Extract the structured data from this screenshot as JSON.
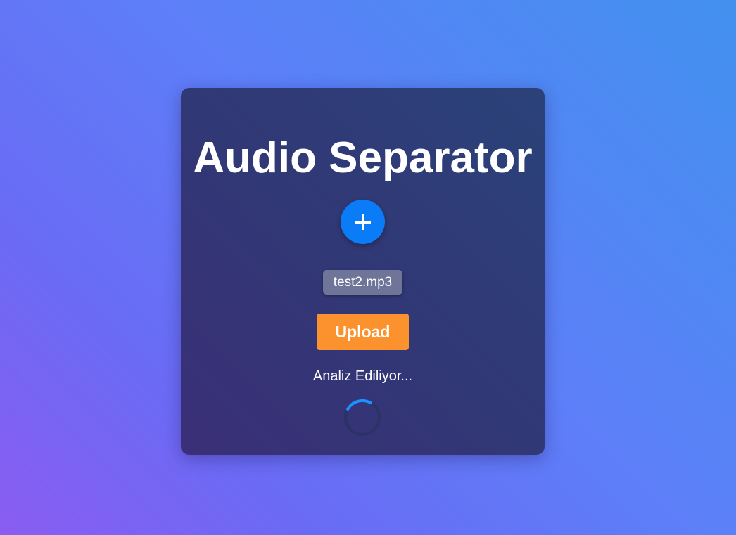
{
  "app": {
    "title": "Audio Separator"
  },
  "file": {
    "name": "test2.mp3"
  },
  "actions": {
    "add_symbol": "+",
    "upload_label": "Upload"
  },
  "status": {
    "text": "Analiz Ediliyor..."
  },
  "colors": {
    "accent_blue": "#0a7cf7",
    "upload_orange": "#fc922d",
    "spinner_blue": "#1e90ff"
  },
  "icons": {
    "add": "plus-icon",
    "loading": "spinner-icon"
  }
}
